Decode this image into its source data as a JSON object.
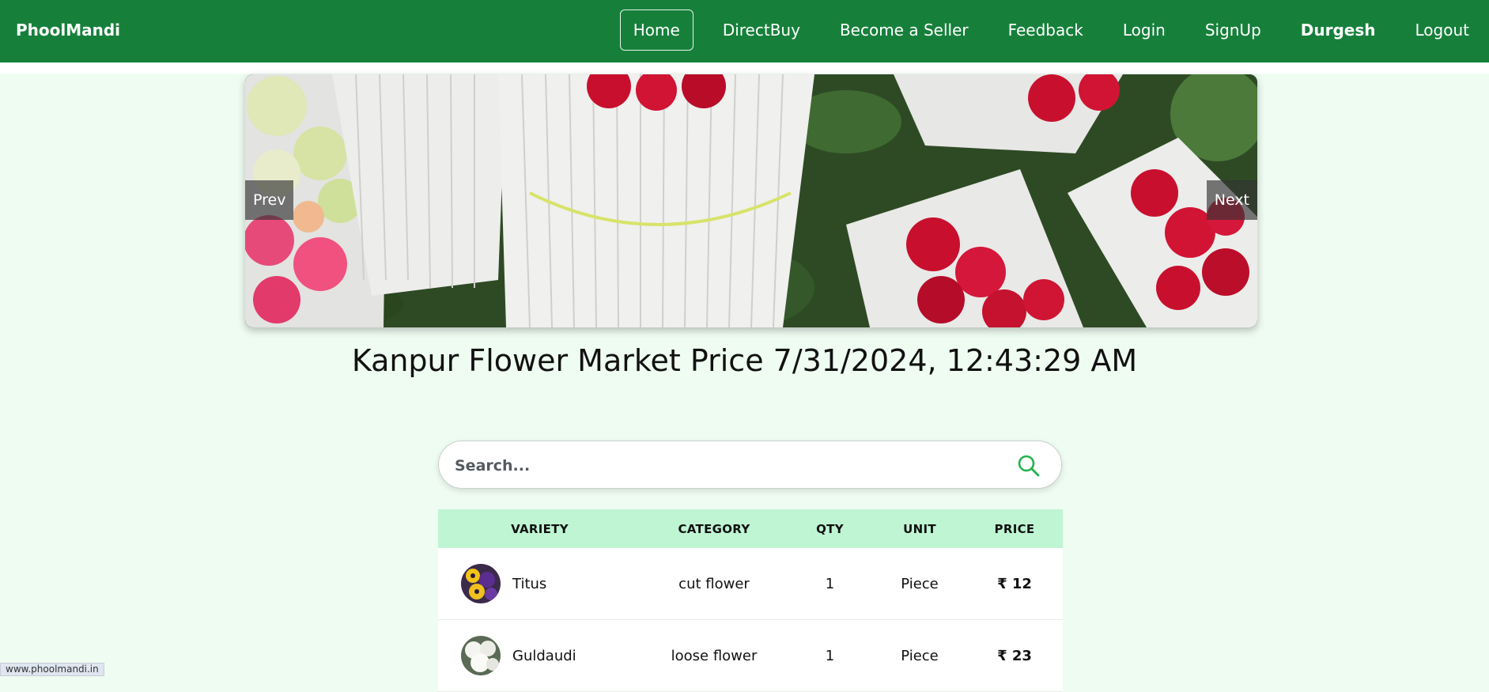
{
  "brand": "PhoolMandi",
  "nav": {
    "home": "Home",
    "directbuy": "DirectBuy",
    "seller": "Become a Seller",
    "feedback": "Feedback",
    "login": "Login",
    "signup": "SignUp",
    "user": "Durgesh",
    "logout": "Logout"
  },
  "carousel": {
    "prev": "Prev",
    "next": "Next"
  },
  "market_title": "Kanpur Flower Market Price 7/31/2024, 12:43:29 AM",
  "search": {
    "placeholder": "Search..."
  },
  "table": {
    "headers": [
      "VARIETY",
      "CATEGORY",
      "QTY",
      "UNIT",
      "PRICE"
    ],
    "rows": [
      {
        "variety": "Titus",
        "category": "cut flower",
        "qty": "1",
        "unit": "Piece",
        "price": "₹ 12"
      },
      {
        "variety": "Guldaudi",
        "category": "loose flower",
        "qty": "1",
        "unit": "Piece",
        "price": "₹ 23"
      }
    ]
  },
  "status_url": "www.phoolmandi.in",
  "colors": {
    "navbar": "#16803b",
    "page_bg": "#effcf2",
    "table_header": "#bff5d3",
    "accent": "#22b24c"
  }
}
